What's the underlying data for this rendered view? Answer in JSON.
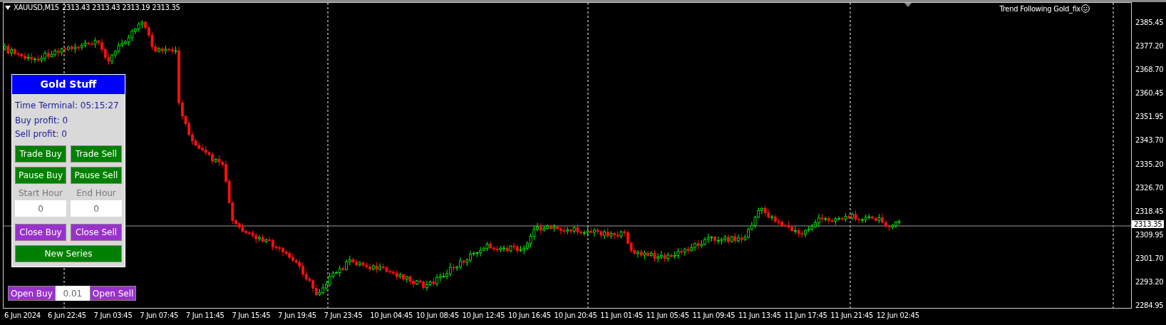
{
  "chart": {
    "symbol": "XAUUSD,M15",
    "ohlc": "2313.43 2313.43 2313.19 2313.35",
    "expert": "Trend Following Gold_fix",
    "price_axis": [
      "2385.45",
      "2377.20",
      "2368.70",
      "2360.45",
      "2351.95",
      "2343.70",
      "2335.20",
      "2326.70",
      "2318.45",
      "2309.95",
      "2301.70",
      "2293.20",
      "2284.95"
    ],
    "current_price": "2313.35",
    "time_axis": [
      "6 Jun 2024",
      "6 Jun 22:45",
      "7 Jun 03:45",
      "7 Jun 07:45",
      "7 Jun 11:45",
      "7 Jun 15:45",
      "7 Jun 19:45",
      "7 Jun 23:45",
      "10 Jun 04:45",
      "10 Jun 08:45",
      "10 Jun 12:45",
      "10 Jun 16:45",
      "10 Jun 20:45",
      "11 Jun 01:45",
      "11 Jun 05:45",
      "11 Jun 09:45",
      "11 Jun 13:45",
      "11 Jun 17:45",
      "11 Jun 21:45",
      "12 Jun 02:45"
    ]
  },
  "panel": {
    "title": "Gold Stuff",
    "time_terminal": "Time Terminal: 05:15:27",
    "buy_profit": "Buy profit: 0",
    "sell_profit": "Sell profit: 0",
    "button_rows": [
      [
        {
          "label": "Trade Buy",
          "color": "#008000"
        },
        {
          "label": "Trade Sell",
          "color": "#008000"
        }
      ],
      [
        {
          "label": "Pause Buy",
          "color": "#008000"
        },
        {
          "label": "Pause Sell",
          "color": "#008000"
        }
      ]
    ],
    "fields": [
      {
        "label": "Start Hour",
        "value": "0"
      },
      {
        "label": "End Hour",
        "value": "0"
      }
    ],
    "close_buttons": [
      {
        "label": "Close Buy",
        "color": "#9932cc"
      },
      {
        "label": "Close Sell",
        "color": "#9932cc"
      }
    ],
    "new_series": {
      "label": "New Series",
      "color": "#008000"
    }
  },
  "quick_trade": {
    "buy": "Open Buy",
    "lot": "0.01",
    "sell": "Open Sell"
  }
}
